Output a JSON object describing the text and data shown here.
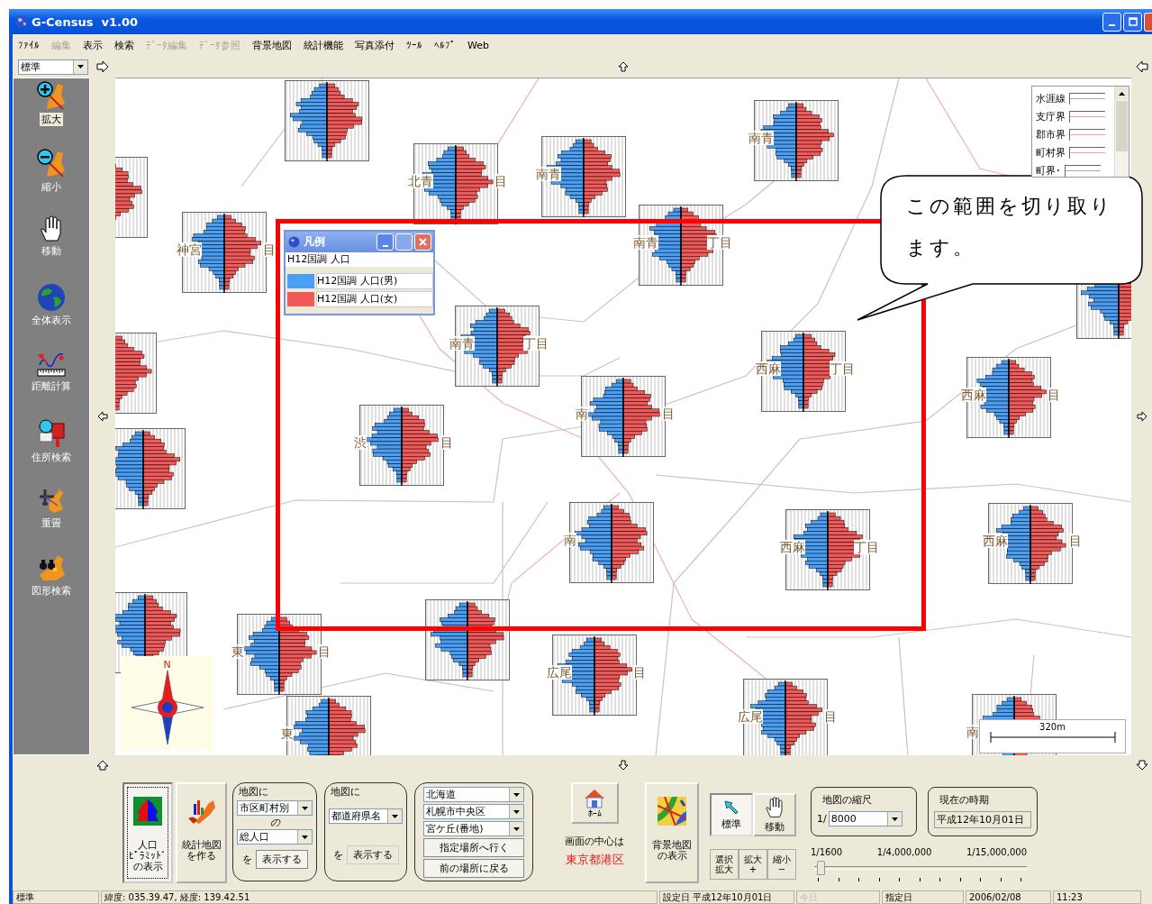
{
  "window": {
    "title": "G-Census  v1.00"
  },
  "menu": [
    {
      "label": "ﾌｧｲﾙ",
      "disabled": false
    },
    {
      "label": "編集",
      "disabled": true
    },
    {
      "label": "表示",
      "disabled": false
    },
    {
      "label": "検索",
      "disabled": false
    },
    {
      "label": "ﾃﾞｰﾀ編集",
      "disabled": true
    },
    {
      "label": "ﾃﾞｰﾀ参照",
      "disabled": true
    },
    {
      "label": "背景地図",
      "disabled": false
    },
    {
      "label": "統計機能",
      "disabled": false
    },
    {
      "label": "写真添付",
      "disabled": false
    },
    {
      "label": "ﾂｰﾙ",
      "disabled": false
    },
    {
      "label": "ﾍﾙﾌﾟ",
      "disabled": false
    },
    {
      "label": "Web",
      "disabled": false
    }
  ],
  "view_select": {
    "value": "標準"
  },
  "tools": [
    {
      "label": "拡大",
      "kind": "zoom-in",
      "selected": true
    },
    {
      "label": "縮小",
      "kind": "zoom-out",
      "selected": false
    },
    {
      "label": "移動",
      "kind": "hand",
      "selected": false
    },
    {
      "label": "全体表示",
      "kind": "globe",
      "selected": false
    },
    {
      "label": "距離計算",
      "kind": "ruler",
      "selected": false
    },
    {
      "label": "住所検索",
      "kind": "mailbox",
      "selected": false
    },
    {
      "label": "重畳",
      "kind": "airplane",
      "selected": false
    },
    {
      "label": "図形検索",
      "kind": "binoculars",
      "selected": false
    }
  ],
  "pyramids": [
    {
      "kind": "pyramid"
    },
    {
      "kind": "pyramid",
      "left": "北青",
      "right": "目"
    },
    {
      "kind": "pyramid",
      "left": "南青"
    },
    {
      "kind": "pyramid",
      "left": "南青"
    },
    {
      "kind": "pyramid"
    },
    {
      "kind": "pyramid",
      "left": "神宮",
      "right": "目"
    },
    {
      "kind": "pyramid",
      "left": "南青",
      "right": "丁目"
    },
    {
      "kind": "pyramid"
    },
    {
      "kind": "pyramid",
      "left": "南青",
      "right": "丁目"
    },
    {
      "kind": "pyramid",
      "left": "西麻",
      "right": "丁目"
    },
    {
      "kind": "pyramid"
    },
    {
      "kind": "pyramid",
      "left": "南",
      "right": "目"
    },
    {
      "kind": "pyramid",
      "left": "西麻",
      "right": "目"
    },
    {
      "kind": "pyramid",
      "left": "渋",
      "right": "目"
    },
    {
      "kind": "pyramid"
    },
    {
      "kind": "pyramid",
      "left": "南"
    },
    {
      "kind": "pyramid",
      "left": "西麻",
      "right": "丁目"
    },
    {
      "kind": "pyramid",
      "left": "西麻",
      "right": "目"
    },
    {
      "kind": "pyramid"
    },
    {
      "kind": "pyramid",
      "left": "東",
      "right": "目"
    },
    {
      "kind": "pyramid"
    },
    {
      "kind": "pyramid",
      "left": "広尾",
      "right": "目"
    },
    {
      "kind": "pyramid",
      "left": "東"
    },
    {
      "kind": "pyramid",
      "left": "広尾",
      "right": "目"
    },
    {
      "kind": "pyramid",
      "left": "南"
    }
  ],
  "legend_window": {
    "title": "凡例",
    "heading": "H12国調 人口",
    "items": [
      {
        "label": "H12国調 人口(男)",
        "color": "#4a9ff5"
      },
      {
        "label": "H12国調 人口(女)",
        "color": "#f25a5a"
      }
    ]
  },
  "line_legend": {
    "items": [
      {
        "label": "水涯線",
        "color": "#a8a8a8"
      },
      {
        "label": "支庁界",
        "color": "#f0a0a0"
      },
      {
        "label": "郡市界",
        "color": "#f0a0a0"
      },
      {
        "label": "町村界",
        "color": "#f0a0a0"
      },
      {
        "label": "町界･",
        "color": "#a8a8a8"
      }
    ]
  },
  "callout": {
    "text": "この範囲を切り取ります。"
  },
  "compass": {
    "north": "N"
  },
  "scale_bar": {
    "label": "320m"
  },
  "bottom_panel": {
    "pyramid_button": {
      "lines": [
        "人口",
        "ﾋﾟﾗﾐｯﾄﾞ",
        "の表示"
      ],
      "selected": true
    },
    "stat_map_button": {
      "lines": [
        "統計地図",
        "を作る"
      ]
    },
    "city_group": {
      "caption": "地図に",
      "unit": "市区町村別",
      "of": "の",
      "item": "総人口",
      "wo": "を",
      "button": "表示する"
    },
    "pref_group": {
      "caption": "地図に",
      "unit": "都道府県名",
      "wo": "を",
      "button": "表示する"
    },
    "place_group": {
      "prefecture": "北海道",
      "city": "札幌市中央区",
      "area": "宮ケ丘(番地)",
      "go_button": "指定場所へ行く",
      "back_button": "前の場所に戻る"
    },
    "home_button": {
      "label": "ﾎｰﾑ"
    },
    "center": {
      "caption": "画面の中心は",
      "place": "東京都港区"
    },
    "background_button": {
      "lines": [
        "背景地図",
        "の表示"
      ]
    },
    "modes": [
      {
        "label": "標準",
        "kind": "arrow",
        "selected": true
      },
      {
        "label": "移動",
        "kind": "hand",
        "selected": false
      }
    ],
    "zoom_buttons": [
      {
        "lines": [
          "選択",
          "拡大"
        ]
      },
      {
        "lines": [
          "拡大",
          "+"
        ]
      },
      {
        "lines": [
          "縮小",
          "−"
        ]
      }
    ],
    "scale": {
      "caption": "地図の縮尺",
      "prefix": "1/",
      "value": "8000"
    },
    "period": {
      "caption": "現在の時期",
      "value": "平成12年10月01日"
    },
    "scale_slider": {
      "ticks": [
        "1/1600",
        "1/4,000,000",
        "1/15,000,000"
      ],
      "level": 0.02
    }
  },
  "status_bar": [
    {
      "text": "標準",
      "disabled": false
    },
    {
      "text": "緯度: 035.39.47, 経度: 139.42.51",
      "disabled": false
    },
    {
      "text": "設定日  平成12年10月01日",
      "disabled": false
    },
    {
      "text": "今日",
      "disabled": true
    },
    {
      "text": "指定日",
      "disabled": false
    },
    {
      "text": "2006/02/08",
      "disabled": false
    },
    {
      "text": "11:23",
      "disabled": false
    }
  ]
}
